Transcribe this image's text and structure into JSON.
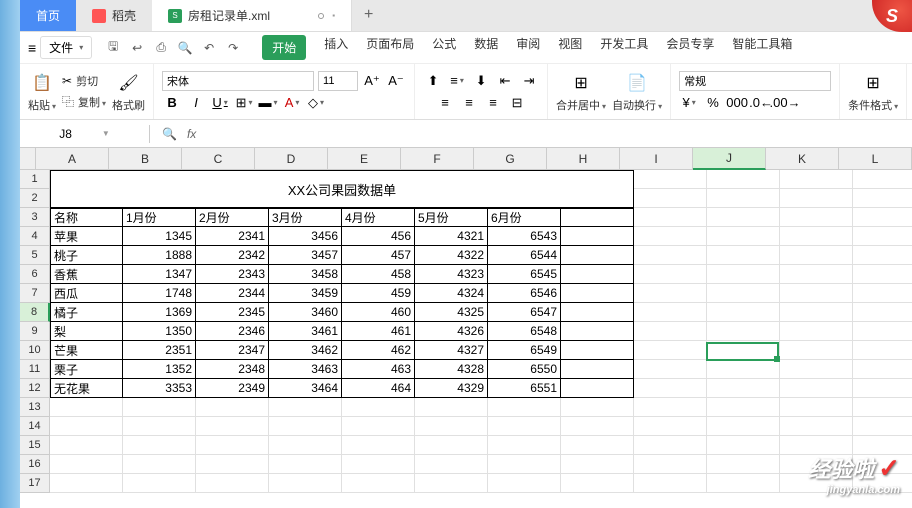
{
  "tabs": {
    "home": "首页",
    "docker": "稻壳",
    "file": "房租记录单.xml"
  },
  "corner": "S",
  "menu": {
    "file": "文件",
    "items": [
      "开始",
      "插入",
      "页面布局",
      "公式",
      "数据",
      "审阅",
      "视图",
      "开发工具",
      "会员专享",
      "智能工具箱"
    ]
  },
  "ribbon": {
    "cut": "剪切",
    "copy": "复制",
    "paste": "粘贴",
    "brush": "格式刷",
    "font": "宋体",
    "size": "11",
    "merge": "合并居中",
    "wrap": "自动换行",
    "numfmt": "常规",
    "condfmt": "条件格式"
  },
  "formula": {
    "name_box": "J8",
    "fx": "fx"
  },
  "cols": [
    "A",
    "B",
    "C",
    "D",
    "E",
    "F",
    "G",
    "H",
    "I",
    "J",
    "K",
    "L"
  ],
  "sheet": {
    "title": "XX公司果园数据单",
    "headers": [
      "名称",
      "1月份",
      "2月份",
      "3月份",
      "4月份",
      "5月份",
      "6月份"
    ],
    "rows": [
      [
        "苹果",
        "1345",
        "2341",
        "3456",
        "456",
        "4321",
        "6543"
      ],
      [
        "桃子",
        "1888",
        "2342",
        "3457",
        "457",
        "4322",
        "6544"
      ],
      [
        "香蕉",
        "1347",
        "2343",
        "3458",
        "458",
        "4323",
        "6545"
      ],
      [
        "西瓜",
        "1748",
        "2344",
        "3459",
        "459",
        "4324",
        "6546"
      ],
      [
        "橘子",
        "1369",
        "2345",
        "3460",
        "460",
        "4325",
        "6547"
      ],
      [
        "梨",
        "1350",
        "2346",
        "3461",
        "461",
        "4326",
        "6548"
      ],
      [
        "芒果",
        "2351",
        "2347",
        "3462",
        "462",
        "4327",
        "6549"
      ],
      [
        "栗子",
        "1352",
        "2348",
        "3463",
        "463",
        "4328",
        "6550"
      ],
      [
        "无花果",
        "3353",
        "2349",
        "3464",
        "464",
        "4329",
        "6551"
      ]
    ]
  },
  "watermark": {
    "main": "经验啦",
    "sub": "jingyanla.com"
  }
}
